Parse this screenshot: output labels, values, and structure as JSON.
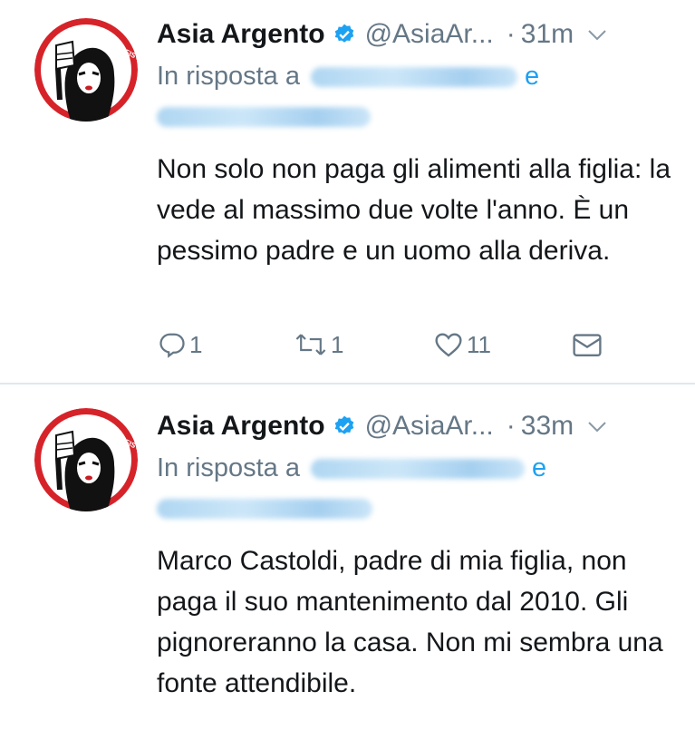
{
  "tweets": [
    {
      "author_name": "Asia Argento",
      "handle": "@AsiaAr...",
      "separator": "·",
      "time": "31m",
      "reply_prefix": "In risposta a",
      "reply_and": "e",
      "text": "Non solo non paga gli alimenti alla figlia: la vede al massimo due volte l'anno. È un pessimo padre e un uomo alla deriva.",
      "reply_count": "1",
      "retweet_count": "1",
      "like_count": "11",
      "avatar_text": "NO SHAME FIST"
    },
    {
      "author_name": "Asia Argento",
      "handle": "@AsiaAr...",
      "separator": "·",
      "time": "33m",
      "reply_prefix": "In risposta a",
      "reply_and": "e",
      "text": "Marco Castoldi, padre di mia figlia, non paga il suo mantenimento dal 2010. Gli pignoreranno la casa. Non mi sembra una fonte attendibile.",
      "avatar_text": "NO SHAME FIST"
    }
  ],
  "icons": {
    "verified": "verified-badge-icon",
    "chevron": "chevron-down-icon",
    "reply": "reply-icon",
    "retweet": "retweet-icon",
    "like": "heart-icon",
    "dm": "envelope-icon"
  },
  "colors": {
    "text": "#14171a",
    "secondary": "#657786",
    "link": "#1da1f2",
    "avatar_red": "#d6232a",
    "divider": "#e1e8ed"
  }
}
